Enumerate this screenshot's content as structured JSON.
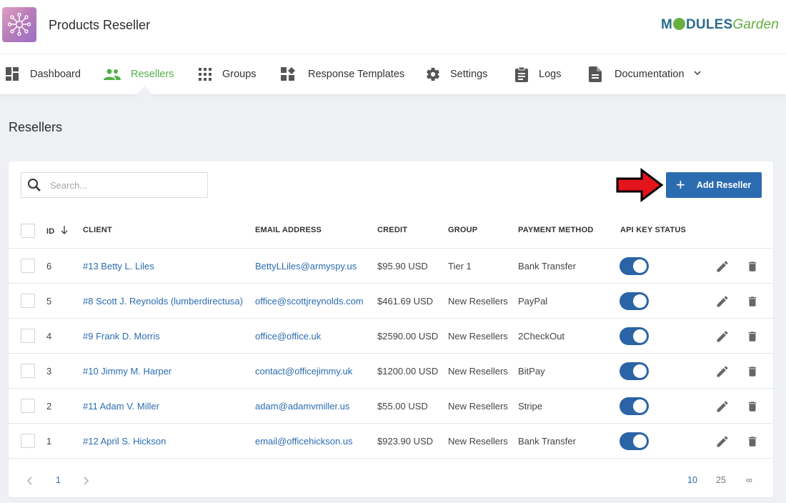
{
  "app": {
    "title": "Products Reseller",
    "icon": "network-hub-icon"
  },
  "brand": {
    "part1_pre": "M",
    "part1_post": "DULES",
    "part2": "Garden"
  },
  "nav": [
    {
      "label": "Dashboard",
      "icon": "dashboard-icon"
    },
    {
      "label": "Resellers",
      "icon": "users-icon",
      "active": true
    },
    {
      "label": "Groups",
      "icon": "grid-icon"
    },
    {
      "label": "Response Templates",
      "icon": "templates-icon"
    },
    {
      "label": "Settings",
      "icon": "gear-icon"
    },
    {
      "label": "Logs",
      "icon": "clipboard-icon"
    },
    {
      "label": "Documentation",
      "icon": "document-icon"
    }
  ],
  "page": {
    "title": "Resellers"
  },
  "search": {
    "placeholder": "Search..."
  },
  "add_button": {
    "label": "Add Reseller"
  },
  "table": {
    "columns": {
      "id": "ID",
      "client": "CLIENT",
      "email": "EMAIL ADDRESS",
      "credit": "CREDIT",
      "group": "GROUP",
      "payment": "PAYMENT METHOD",
      "api": "API KEY STATUS"
    },
    "rows": [
      {
        "id": "6",
        "client": "#13 Betty L. Liles",
        "email": "BettyLLiles@armyspy.us",
        "credit": "$95.90 USD",
        "group": "Tier 1",
        "payment": "Bank Transfer",
        "api_enabled": true
      },
      {
        "id": "5",
        "client": "#8 Scott J. Reynolds (lumberdirectusa)",
        "email": "office@scottjreynolds.com",
        "credit": "$461.69 USD",
        "group": "New Resellers",
        "payment": "PayPal",
        "api_enabled": true
      },
      {
        "id": "4",
        "client": "#9 Frank D. Morris",
        "email": "office@office.uk",
        "credit": "$2590.00 USD",
        "group": "New Resellers",
        "payment": "2CheckOut",
        "api_enabled": true
      },
      {
        "id": "3",
        "client": "#10 Jimmy M. Harper",
        "email": "contact@officejimmy.uk",
        "credit": "$1200.00 USD",
        "group": "New Resellers",
        "payment": "BitPay",
        "api_enabled": true
      },
      {
        "id": "2",
        "client": "#11 Adam V. Miller",
        "email": "adam@adamvmiller.us",
        "credit": "$55.00 USD",
        "group": "New Resellers",
        "payment": "Stripe",
        "api_enabled": true
      },
      {
        "id": "1",
        "client": "#12 April S. Hickson",
        "email": "email@officehickson.us",
        "credit": "$923.90 USD",
        "group": "New Resellers",
        "payment": "Bank Transfer",
        "api_enabled": true
      }
    ]
  },
  "pagination": {
    "current_page": "1",
    "page_sizes": [
      "10",
      "25",
      "∞"
    ],
    "selected_size": "10"
  },
  "colors": {
    "accent": "#2b6cb0",
    "active_nav": "#55b04a",
    "toggle_on": "#2b64a6",
    "arrow": "#e3141b"
  }
}
